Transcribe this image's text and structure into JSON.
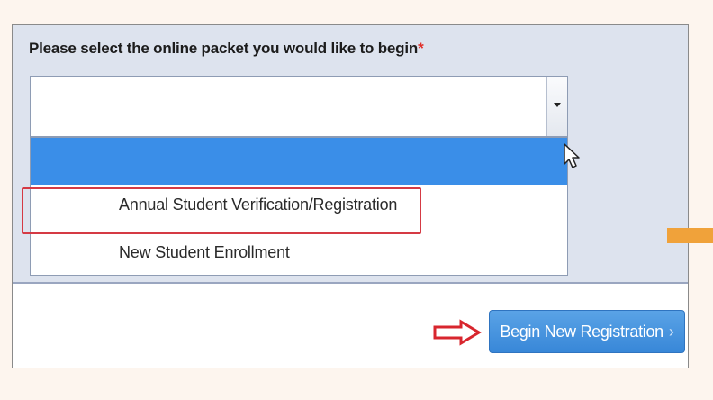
{
  "form": {
    "prompt": "Please select the online packet you would like to begin",
    "required_marker": "*"
  },
  "select": {
    "value": "",
    "highlighted_option": "",
    "options": [
      "Annual Student Verification/Registration",
      "New Student Enrollment"
    ]
  },
  "actions": {
    "begin_label": "Begin New Registration",
    "begin_chevron": "›"
  },
  "colors": {
    "highlight_blue": "#3a8ee8",
    "callout_red": "#d53a44",
    "button_blue": "#3887d8",
    "orange_marker": "#f0a23a"
  },
  "icons": [
    "chevron-down-icon",
    "mouse-pointer-icon",
    "red-arrow-icon",
    "chevron-right-icon"
  ]
}
